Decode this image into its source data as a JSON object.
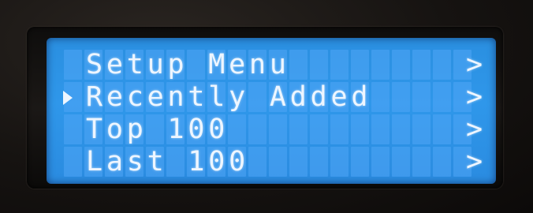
{
  "menu": {
    "items": [
      {
        "label": "Setup Menu",
        "arrow": ">",
        "selected": false
      },
      {
        "label": "Recently Added",
        "arrow": ">",
        "selected": true
      },
      {
        "label": "Top 100",
        "arrow": ">",
        "selected": false
      },
      {
        "label": "Last 100",
        "arrow": ">",
        "selected": false
      }
    ]
  },
  "colors": {
    "lcd_background": "#2f97ea",
    "character_color": "#eef6ff",
    "bezel": "#1b1816"
  }
}
